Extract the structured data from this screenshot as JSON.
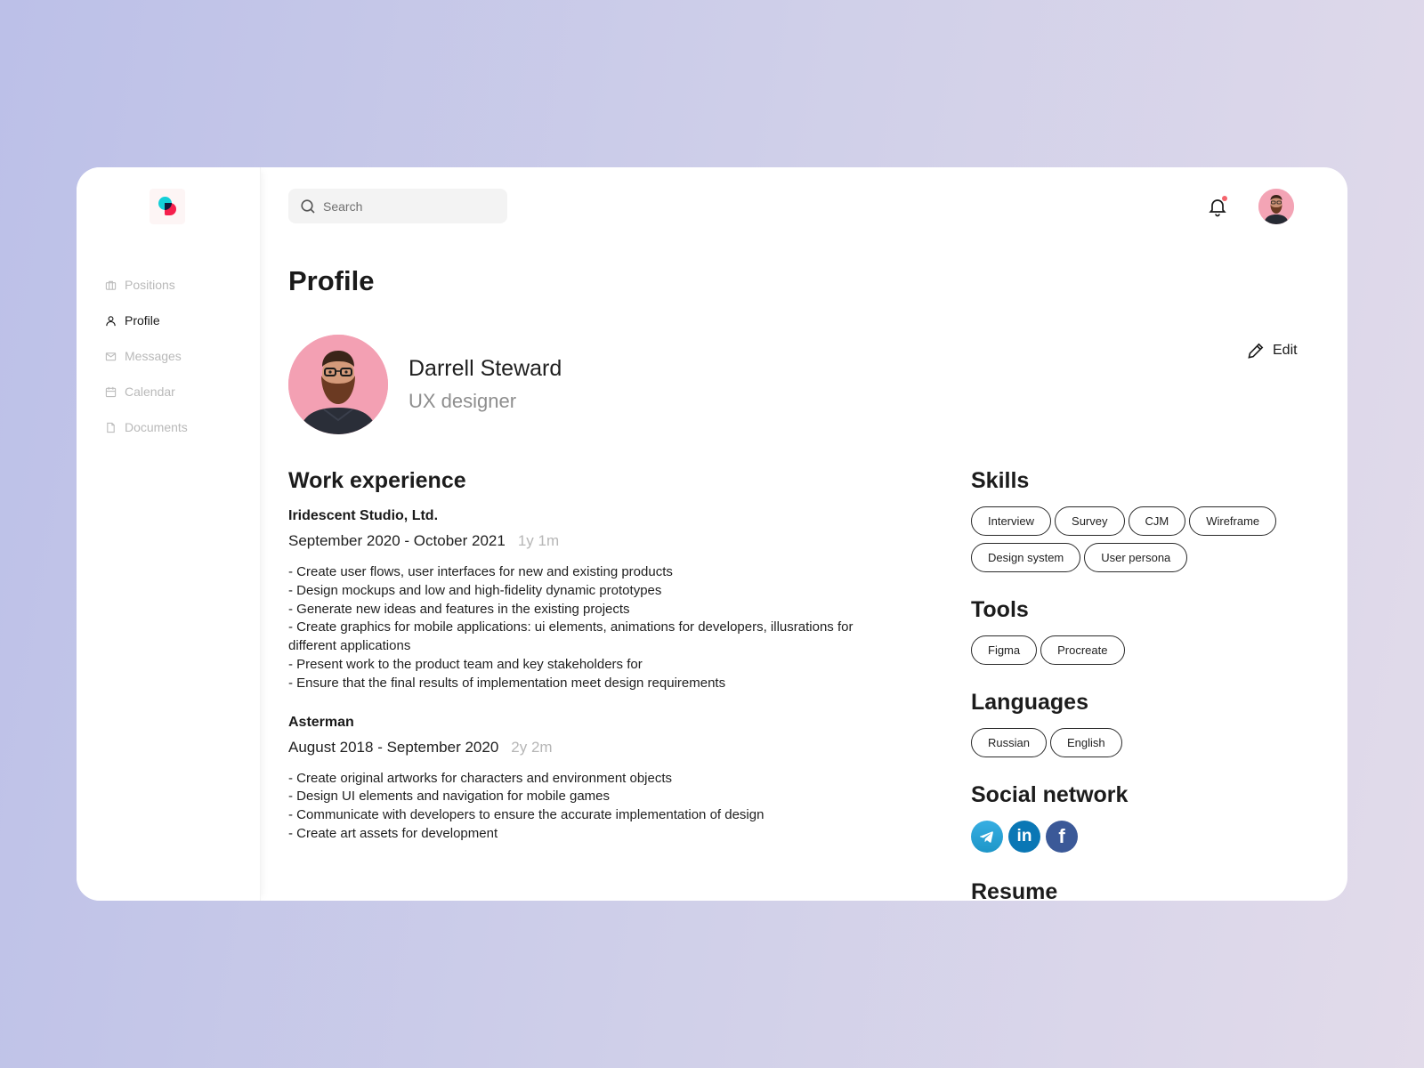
{
  "sidebar": {
    "items": [
      {
        "label": "Positions",
        "icon": "briefcase-icon",
        "active": false
      },
      {
        "label": "Profile",
        "icon": "user-icon",
        "active": true
      },
      {
        "label": "Messages",
        "icon": "mail-icon",
        "active": false
      },
      {
        "label": "Calendar",
        "icon": "calendar-icon",
        "active": false
      },
      {
        "label": "Documents",
        "icon": "document-icon",
        "active": false
      }
    ]
  },
  "header": {
    "search_placeholder": "Search",
    "search_value": "",
    "notification_unread": true
  },
  "page": {
    "title": "Profile",
    "edit_label": "Edit"
  },
  "person": {
    "name": "Darrell Steward",
    "role": "UX designer"
  },
  "work": {
    "title": "Work experience",
    "jobs": [
      {
        "company": "Iridescent Studio, Ltd.",
        "period": "September 2020 - October 2021",
        "duration": "1y 1m",
        "duties": [
          "- Create user flows, user interfaces for new and existing products",
          "- Design mockups and low and high-fidelity dynamic prototypes",
          "- Generate new ideas and features in the existing projects",
          "- Create graphics for mobile applications: ui elements, animations for developers, illusrations for different applications",
          "- Present work to the product team and key stakeholders for",
          "- Ensure that the final results of implementation meet design requirements"
        ]
      },
      {
        "company": "Asterman",
        "period": "August 2018 - September 2020",
        "duration": "2y 2m",
        "duties": [
          "- Create original artworks for characters and environment objects",
          "- Design UI elements and navigation for mobile games",
          "- Communicate with developers to ensure the accurate implementation of design",
          "- Create art assets for development"
        ]
      }
    ]
  },
  "skills": {
    "title": "Skills",
    "items": [
      "Interview",
      "Survey",
      "CJM",
      "Wireframe",
      "Design system",
      "User persona"
    ]
  },
  "tools": {
    "title": "Tools",
    "items": [
      "Figma",
      "Procreate"
    ]
  },
  "languages": {
    "title": "Languages",
    "items": [
      "Russian",
      "English"
    ]
  },
  "social": {
    "title": "Social network",
    "items": [
      {
        "name": "telegram",
        "glyph": ""
      },
      {
        "name": "linkedin",
        "glyph": "in"
      },
      {
        "name": "facebook",
        "glyph": "f"
      }
    ]
  },
  "resume": {
    "title": "Resume"
  },
  "colors": {
    "notification_dot": "#f4646c",
    "telegram": "#2aa3d8",
    "linkedin": "#0a77b5",
    "facebook": "#3b5998"
  }
}
